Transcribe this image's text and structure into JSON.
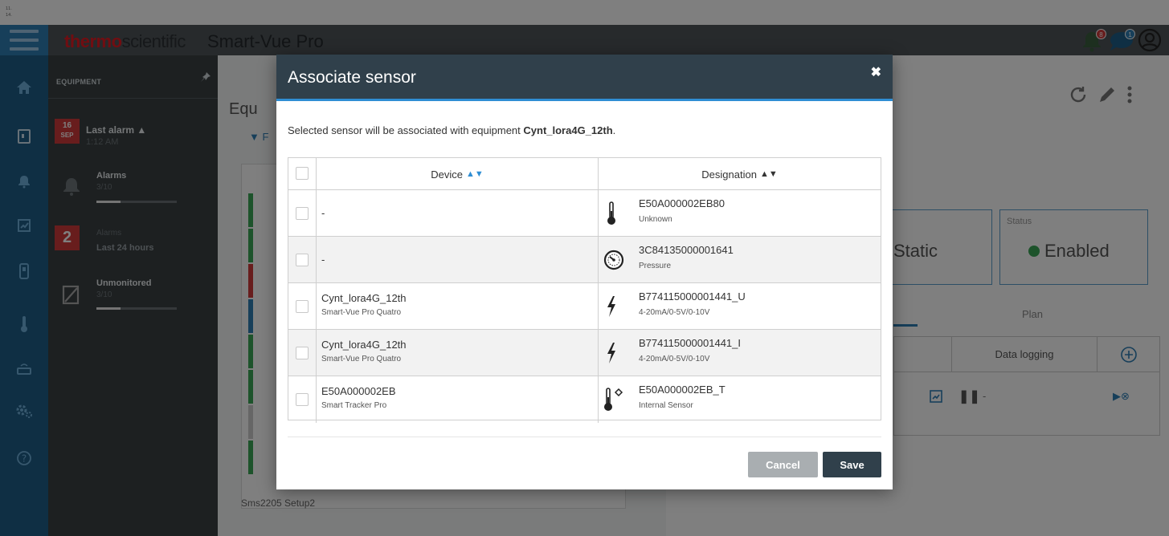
{
  "top_strip": {
    "line1": "11.",
    "line2": "14."
  },
  "header": {
    "brand_red": "thermo",
    "brand_gray": "scientific",
    "app_name": "Smart-Vue Pro",
    "alarm_badge": "8",
    "message_badge": "1"
  },
  "equipment_panel": {
    "title": "EQUIPMENT",
    "last_alarm": {
      "day": "16",
      "month": "SEP",
      "label": "Last alarm",
      "time": "1:12 AM"
    },
    "alarms": {
      "label": "Alarms",
      "value": "3/10",
      "fraction": 0.3
    },
    "last24": {
      "count": "2",
      "label_top": "Alarms",
      "label": "Last 24 hours"
    },
    "unmonitored": {
      "label": "Unmonitored",
      "value": "3/10",
      "fraction": 0.3
    }
  },
  "background_page": {
    "title": "Equ",
    "filter": "F",
    "list_bottom_item": "Sms2205 Setup2",
    "static_label": "Static",
    "status_label": "Status",
    "status_value": "Enabled",
    "plan_tab": "Plan",
    "data_logging": "Data logging",
    "data_logging_value": "-"
  },
  "modal": {
    "title": "Associate sensor",
    "intro_prefix": "Selected sensor will be associated with equipment ",
    "intro_equipment": "Cynt_lora4G_12th",
    "intro_suffix": ".",
    "columns": {
      "device": "Device",
      "designation": "Designation"
    },
    "rows": [
      {
        "device": "-",
        "device_sub": "",
        "designation": "E50A000002EB80",
        "designation_sub": "Unknown",
        "icon": "thermometer-icon"
      },
      {
        "device": "-",
        "device_sub": "",
        "designation": "3C84135000001641",
        "designation_sub": "Pressure",
        "icon": "pressure-gauge-icon"
      },
      {
        "device": "Cynt_lora4G_12th",
        "device_sub": "Smart-Vue Pro Quatro",
        "designation": "B774115000001441_U",
        "designation_sub": "4-20mA/0-5V/0-10V",
        "icon": "lightning-icon"
      },
      {
        "device": "Cynt_lora4G_12th",
        "device_sub": "Smart-Vue Pro Quatro",
        "designation": "B774115000001441_I",
        "designation_sub": "4-20mA/0-5V/0-10V",
        "icon": "lightning-icon"
      },
      {
        "device": "E50A000002EB",
        "device_sub": "Smart Tracker Pro",
        "designation": "E50A000002EB_T",
        "designation_sub": "Internal Sensor",
        "icon": "internal-thermometer-icon"
      }
    ],
    "cancel_label": "Cancel",
    "save_label": "Save",
    "close_glyph": "✖"
  },
  "colors": {
    "brand_red": "#e21b23",
    "nav_blue": "#1f5e88",
    "modal_header": "#30404b",
    "accent_blue": "#2f8ed4",
    "alarm_red": "#d13b3b",
    "enabled_green": "#3aa757"
  }
}
